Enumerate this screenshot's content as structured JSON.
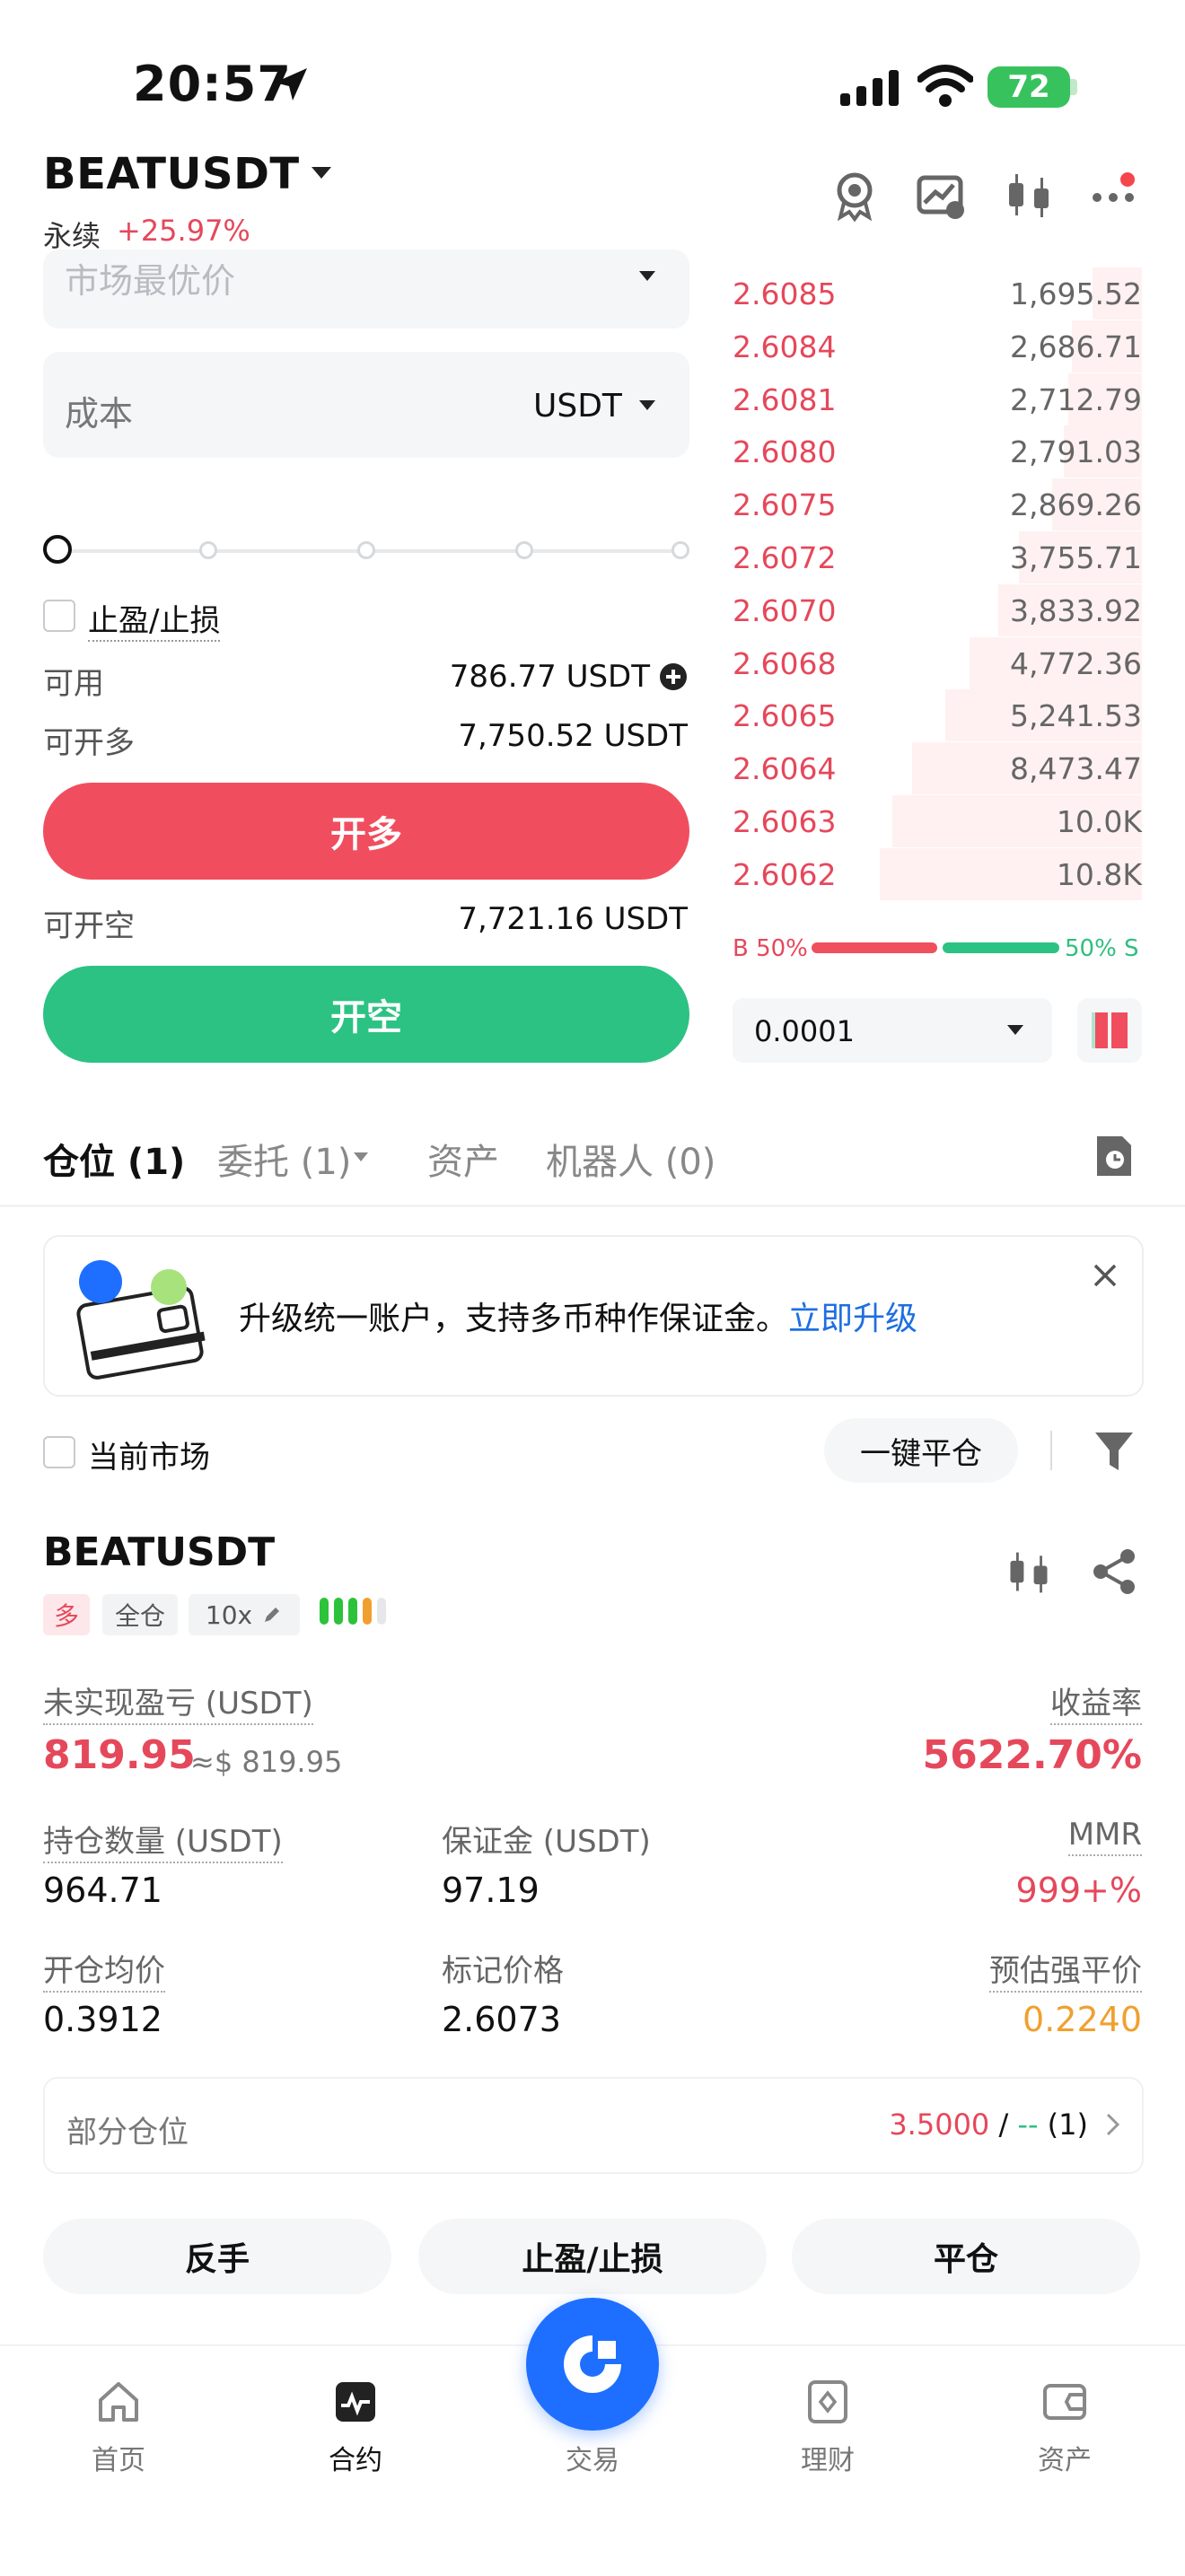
{
  "status_bar": {
    "time": "20:57",
    "battery": "72"
  },
  "header": {
    "pair": "BEATUSDT",
    "type": "永续",
    "change": "+25.97%"
  },
  "form": {
    "order_type_placeholder": "市场最优价",
    "cost_label": "成本",
    "cost_unit": "USDT",
    "tpsl_label": "止盈/止损",
    "available_label": "可用",
    "available_value": "786.77 USDT",
    "open_long_label": "可开多",
    "open_long_value": "7,750.52 USDT",
    "long_button": "开多",
    "open_short_label": "可开空",
    "open_short_value": "7,721.16 USDT",
    "short_button": "开空"
  },
  "orderbook": {
    "rows": [
      {
        "price": "2.6085",
        "qty": "1,695.52",
        "depth": 0.12
      },
      {
        "price": "2.6084",
        "qty": "2,686.71",
        "depth": 0.17
      },
      {
        "price": "2.6081",
        "qty": "2,712.79",
        "depth": 0.18
      },
      {
        "price": "2.6080",
        "qty": "2,791.03",
        "depth": 0.19
      },
      {
        "price": "2.6075",
        "qty": "2,869.26",
        "depth": 0.22
      },
      {
        "price": "2.6072",
        "qty": "3,755.71",
        "depth": 0.3
      },
      {
        "price": "2.6070",
        "qty": "3,833.92",
        "depth": 0.35
      },
      {
        "price": "2.6068",
        "qty": "4,772.36",
        "depth": 0.42
      },
      {
        "price": "2.6065",
        "qty": "5,241.53",
        "depth": 0.48
      },
      {
        "price": "2.6064",
        "qty": "8,473.47",
        "depth": 0.56
      },
      {
        "price": "2.6063",
        "qty": "10.0K",
        "depth": 0.61
      },
      {
        "price": "2.6062",
        "qty": "10.8K",
        "depth": 0.64
      }
    ],
    "buy_ratio": "B 50%",
    "sell_ratio": "50% S",
    "precision": "0.0001"
  },
  "tabs": {
    "positions": "仓位 (1)",
    "orders": "委托 (1)",
    "assets": "资产",
    "bots": "机器人 (0)"
  },
  "banner": {
    "text": "升级统一账户，支持多币种作保证金。",
    "link": "立即升级"
  },
  "filters": {
    "current_market": "当前市场",
    "close_all": "一键平仓"
  },
  "position": {
    "symbol": "BEATUSDT",
    "side": "多",
    "margin_mode": "全仓",
    "leverage": "10x",
    "unrealized_label": "未实现盈亏 (USDT)",
    "unrealized_value": "819.95",
    "unrealized_usd": "≈$ 819.95",
    "roe_label": "收益率",
    "roe_value": "5622.70%",
    "size_label": "持仓数量 (USDT)",
    "size_value": "964.71",
    "margin_label": "保证金 (USDT)",
    "margin_value": "97.19",
    "mmr_label": "MMR",
    "mmr_value": "999+%",
    "entry_label": "开仓均价",
    "entry_value": "0.3912",
    "mark_label": "标记价格",
    "mark_value": "2.6073",
    "liq_label": "预估强平价",
    "liq_value": "0.2240",
    "partial_label": "部分仓位",
    "partial_price": "3.5000",
    "partial_sep": " / ",
    "partial_dash": "--",
    "partial_count": " (1)",
    "reverse_button": "反手",
    "tpsl_button": "止盈/止损",
    "close_button": "平仓"
  },
  "nav": {
    "home": "首页",
    "contract": "合约",
    "trade": "交易",
    "finance": "理财",
    "assets": "资产"
  },
  "colors": {
    "long": "#f04e5f",
    "short": "#2cc283",
    "accent": "#1e6fff",
    "link": "#1e6fe0"
  }
}
